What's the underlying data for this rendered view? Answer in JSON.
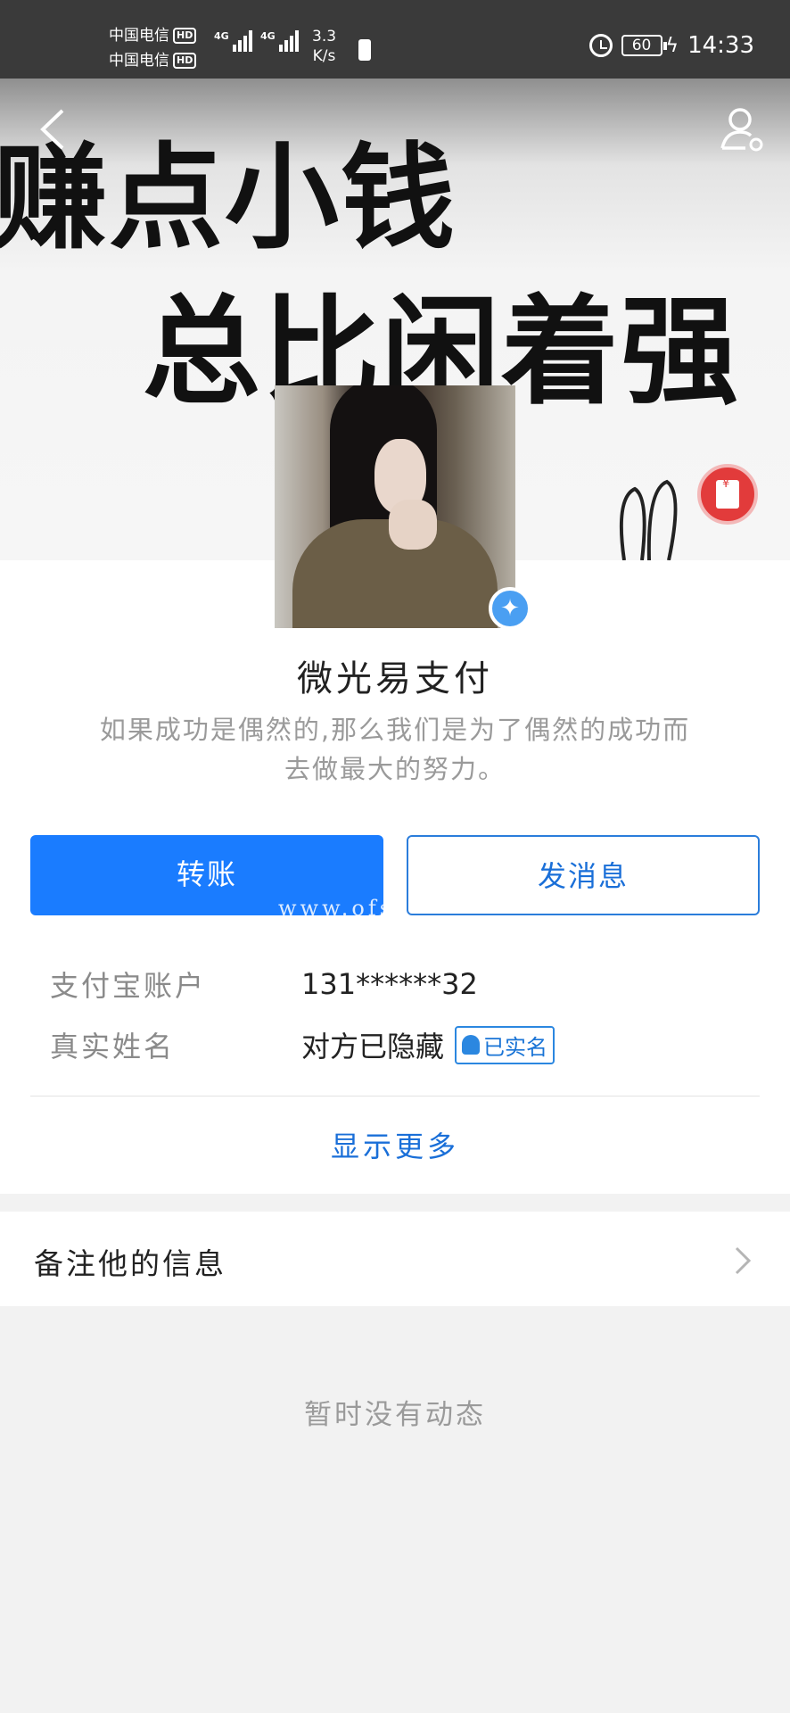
{
  "status_bar": {
    "carrier_1": "中国电信",
    "carrier_2": "中国电信",
    "hd_label": "HD",
    "network_1": "4G",
    "network_2": "4G",
    "speed_value": "3.3",
    "speed_unit": "K/s",
    "battery_level": "60",
    "time": "14:33"
  },
  "cover": {
    "line_1": "赚点小钱",
    "line_2": "总比闲着强"
  },
  "profile": {
    "name": "微光易支付",
    "signature": "如果成功是偶然的,那么我们是为了偶然的成功而去做最大的努力。"
  },
  "actions": {
    "transfer": "转账",
    "message": "发消息"
  },
  "watermark": "www.ofs",
  "info": {
    "account_label": "支付宝账户",
    "account_value": "131******32",
    "realname_label": "真实姓名",
    "realname_value": "对方已隐藏",
    "realname_badge": "已实名"
  },
  "show_more": "显示更多",
  "note": {
    "label": "备注他的信息"
  },
  "empty_state": "暂时没有动态",
  "colors": {
    "primary": "#1a7cff",
    "link": "#1a6fd8",
    "status_bar": "#3a3a3a"
  }
}
